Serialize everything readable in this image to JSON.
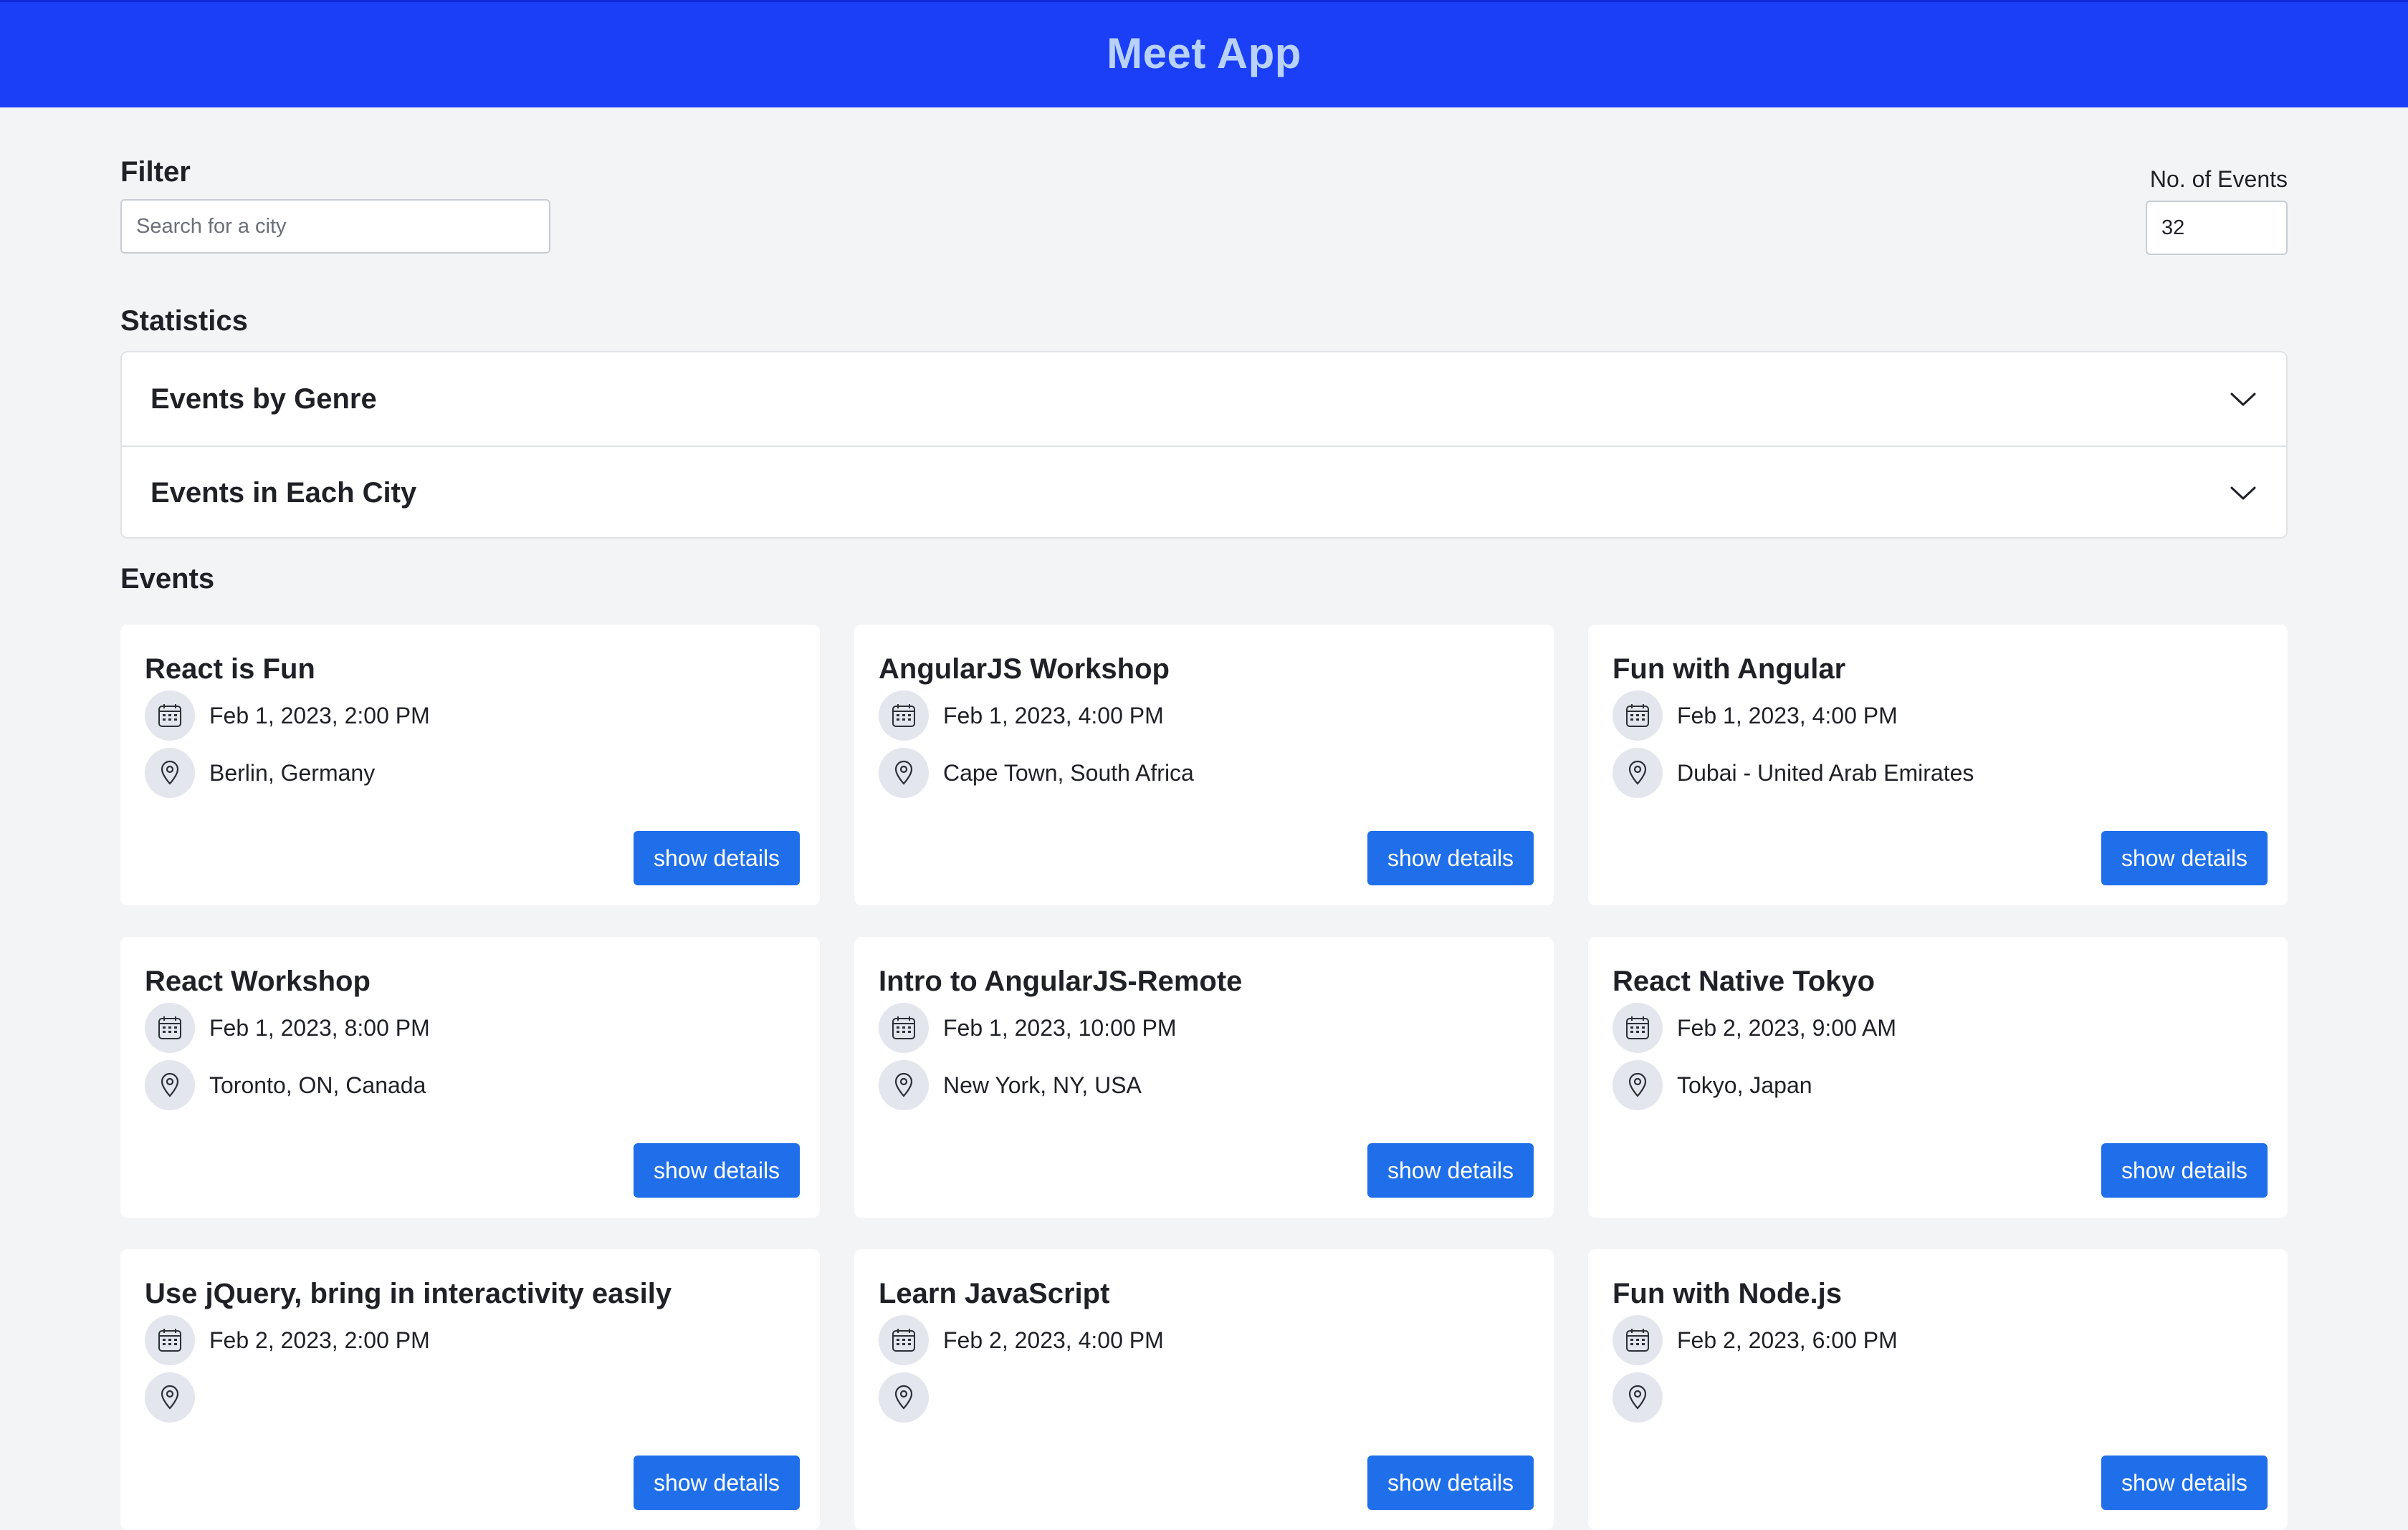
{
  "header": {
    "title": "Meet App",
    "bg_color": "#1a3ff7",
    "title_color": "#b9d2fb"
  },
  "filter": {
    "label": "Filter",
    "placeholder": "Search for a city",
    "value": ""
  },
  "number_of_events": {
    "label": "No. of Events",
    "value": "32"
  },
  "statistics": {
    "label": "Statistics",
    "panels": [
      {
        "title": "Events by Genre",
        "icon": "chevron-down-icon"
      },
      {
        "title": "Events in Each City",
        "icon": "chevron-down-icon"
      }
    ]
  },
  "events": {
    "label": "Events",
    "button_label": "show details",
    "button_color": "#1f6fea",
    "items": [
      {
        "title": "React is Fun",
        "datetime": "Feb 1, 2023, 2:00 PM",
        "location": "Berlin, Germany"
      },
      {
        "title": "AngularJS Workshop",
        "datetime": "Feb 1, 2023, 4:00 PM",
        "location": "Cape Town, South Africa"
      },
      {
        "title": "Fun with Angular",
        "datetime": "Feb 1, 2023, 4:00 PM",
        "location": "Dubai - United Arab Emirates"
      },
      {
        "title": "React Workshop",
        "datetime": "Feb 1, 2023, 8:00 PM",
        "location": "Toronto, ON, Canada"
      },
      {
        "title": "Intro to AngularJS-Remote",
        "datetime": "Feb 1, 2023, 10:00 PM",
        "location": "New York, NY, USA"
      },
      {
        "title": "React Native Tokyo",
        "datetime": "Feb 2, 2023, 9:00 AM",
        "location": "Tokyo, Japan"
      },
      {
        "title": "Use jQuery, bring in interactivity easily",
        "datetime": "Feb 2, 2023, 2:00 PM",
        "location": ""
      },
      {
        "title": "Learn JavaScript",
        "datetime": "Feb 2, 2023, 4:00 PM",
        "location": ""
      },
      {
        "title": "Fun with Node.js",
        "datetime": "Feb 2, 2023, 6:00 PM",
        "location": ""
      }
    ]
  }
}
